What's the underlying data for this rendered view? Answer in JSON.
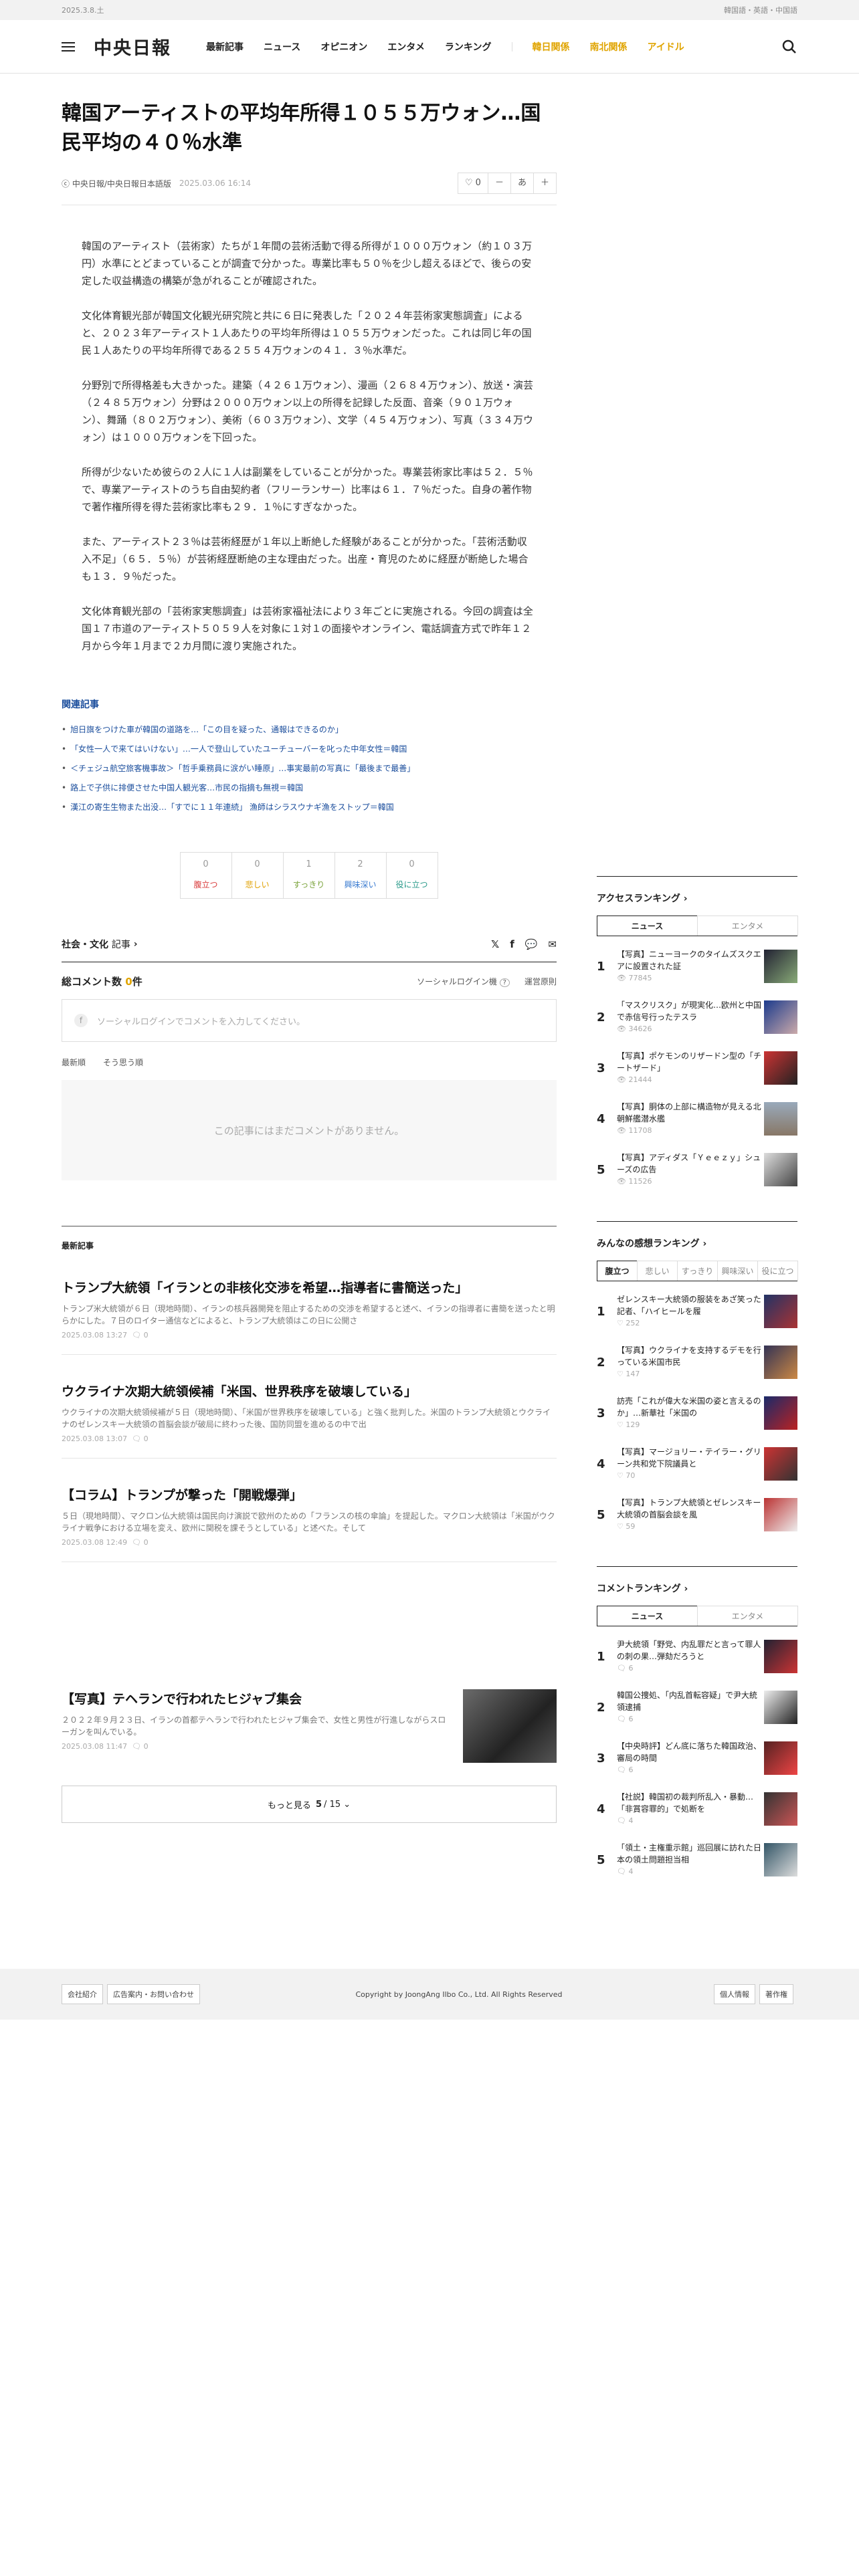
{
  "topbar": {
    "date": "2025.3.8.土",
    "langs": "韓国語・英語・中国語"
  },
  "header": {
    "logo": "中央日報",
    "nav": [
      "最新記事",
      "ニュース",
      "オピニオン",
      "エンタメ",
      "ランキング"
    ],
    "nav_hl": [
      "韓日関係",
      "南北関係",
      "アイドル"
    ]
  },
  "article": {
    "title": "韓国アーティストの平均年所得１０５５万ウォン…国民平均の４０％水準",
    "source": "中央日報/中央日報日本語版",
    "date": "2025.03.06 16:14",
    "likes": "0",
    "tools": {
      "minus": "－",
      "font": "あ",
      "plus": "＋"
    },
    "paragraphs": [
      "韓国のアーティスト（芸術家）たちが１年間の芸術活動で得る所得が１０００万ウォン（約１０３万円）水準にとどまっていることが調査で分かった。専業比率も５０％を少し超えるほどで、後らの安定した収益構造の構築が急がれることが確認された。",
      "文化体育観光部が韓国文化観光研究院と共に６日に発表した「２０２４年芸術家実態調査」によると、２０２３年アーティスト１人あたりの平均年所得は１０５５万ウォンだった。これは同じ年の国民１人あたりの平均年所得である２５５４万ウォンの４１．３％水準だ。",
      "分野別で所得格差も大きかった。建築（４２６１万ウォン）、漫画（２６８４万ウォン）、放送・演芸（２４８５万ウォン）分野は２０００万ウォン以上の所得を記録した反面、音楽（９０１万ウォン）、舞踊（８０２万ウォン）、美術（６０３万ウォン）、文学（４５４万ウォン）、写真（３３４万ウォン）は１０００万ウォンを下回った。",
      "所得が少ないため彼らの２人に１人は副業をしていることが分かった。専業芸術家比率は５２．５％で、専業アーティストのうち自由契約者（フリーランサー）比率は６１．７％だった。自身の著作物で著作権所得を得た芸術家比率も２９．１％にすぎなかった。",
      "また、アーティスト２３％は芸術経歴が１年以上断絶した経験があることが分かった。「芸術活動収入不足」（６５．５％）が芸術経歴断絶の主な理由だった。出産・育児のために経歴が断絶した場合も１３．９％だった。",
      "文化体育観光部の「芸術家実態調査」は芸術家福祉法により３年ごとに実施される。今回の調査は全国１７市道のアーティスト５０５９人を対象に１対１の面接やオンライン、電話調査方式で昨年１２月から今年１月まで２カ月間に渡り実施された。"
    ]
  },
  "related": {
    "title": "関連記事",
    "items": [
      "旭日旗をつけた車が韓国の道路を…「この目を疑った、通報はできるのか」",
      "「女性一人で来てはいけない」…一人で登山していたユーチューバーを叱った中年女性＝韓国",
      "＜チェジュ航空旅客機事故＞「哲手乗務員に涙がい睡原」…事実最前の写真に「最後まで最善」",
      "路上で子供に排便させた中国人観光客…市民の指摘も無視＝韓国",
      "漢江の寄生生物また出没…「すでに１１年連続」 漁師はシラスウナギ漁をストップ＝韓国"
    ]
  },
  "reactions": [
    {
      "count": "0",
      "label": "腹立つ",
      "color": "#d93c3c"
    },
    {
      "count": "0",
      "label": "悲しい",
      "color": "#e0a000"
    },
    {
      "count": "1",
      "label": "すっきり",
      "color": "#7aa33a"
    },
    {
      "count": "2",
      "label": "興味深い",
      "color": "#3a7bd0"
    },
    {
      "count": "0",
      "label": "役に立つ",
      "color": "#2a9a8a"
    }
  ],
  "section": {
    "name": "社会・文化",
    "suffix": "記事",
    "share": [
      "𝕏",
      "f",
      "💬",
      "✉"
    ]
  },
  "comments": {
    "label": "総コメント数",
    "count": "0",
    "unit": "件",
    "login": "ソーシャルログイン機",
    "help": "?",
    "policy": "運営原則",
    "placeholder": "ソーシャルログインでコメントを入力してください。",
    "sort": [
      "最新順",
      "そう思う順"
    ],
    "empty": "この記事にはまだコメントがありません。"
  },
  "latest": {
    "title": "最新記事",
    "items": [
      {
        "title": "トランプ大統領「イランとの非核化交渉を希望…指導者に書簡送った」",
        "desc": "トランプ米大統領が６日（現地時間）、イランの核兵器開発を阻止するための交渉を希望すると述べ、イランの指導者に書簡を送ったと明らかにした。７日のロイター通信などによると、トランプ大統領はこの日に公開さ",
        "date": "2025.03.08 13:27",
        "cm": "0"
      },
      {
        "title": "ウクライナ次期大統領候補「米国、世界秩序を破壊している」",
        "desc": "ウクライナの次期大統領候補が５日（現地時間）、「米国が世界秩序を破壊している」と強く批判した。米国のトランプ大統領とウクライナのゼレンスキー大統領の首脳会談が破局に終わった後、国防同盟を進めるの中で出",
        "date": "2025.03.08 13:07",
        "cm": "0"
      },
      {
        "title": "【コラム】トランプが撃った「開戦爆弾」",
        "desc": "５日（現地時間）、マクロン仏大統領は国民向け演説で欧州のための「フランスの核の傘論」を提起した。マクロン大統領は「米国がウクライナ戦争における立場を変え、欧州に関税を課そうとしている」と述べた。そして",
        "date": "2025.03.08 12:49",
        "cm": "0"
      }
    ],
    "photo": {
      "title": "【写真】テヘランで行われたヒジャブ集会",
      "desc": "２０２２年９月２３日、イランの首都テヘランで行われたヒジャブ集会で、女性と男性が行進しながらスローガンを叫んでいる。",
      "date": "2025.03.08 11:47",
      "cm": "0"
    },
    "more": {
      "label": "もっと見る",
      "page": "5",
      "total": "15"
    }
  },
  "access": {
    "title": "アクセスランキング",
    "tabs": [
      "ニュース",
      "エンタメ"
    ],
    "items": [
      {
        "n": "1",
        "t": "【写真】ニューヨークのタイムズスクエアに設置された証",
        "v": "77845"
      },
      {
        "n": "2",
        "t": "「マスクリスク」が現実化…欧州と中国で赤信号行ったテスラ",
        "v": "34626"
      },
      {
        "n": "3",
        "t": "【写真】ポケモンのリザードン型の「チートザード」",
        "v": "21444"
      },
      {
        "n": "4",
        "t": "【写真】胴体の上部に構造物が見える北朝鮮艦潜水艦",
        "v": "11708"
      },
      {
        "n": "5",
        "t": "【写真】アディダス「Ｙｅｅｚｙ」シューズの広告",
        "v": "11526"
      }
    ]
  },
  "thanks": {
    "title": "みんなの感想ランキング",
    "tabs": [
      "腹立つ",
      "悲しい",
      "すっきり",
      "興味深い",
      "役に立つ"
    ],
    "items": [
      {
        "n": "1",
        "t": "ゼレンスキー大統領の服装をあざ笑った記者、「ハイヒールを履",
        "v": "252"
      },
      {
        "n": "2",
        "t": "【写真】ウクライナを支持するデモを行っている米国市民",
        "v": "147"
      },
      {
        "n": "3",
        "t": "訪売「これが偉大な米国の姿と言えるのか」…新華社「米国の",
        "v": "129"
      },
      {
        "n": "4",
        "t": "【写真】マージョリー・テイラー・グリーン共和党下院議員と",
        "v": "70"
      },
      {
        "n": "5",
        "t": "【写真】トランプ大統領とゼレンスキー大統領の首脳会談を風",
        "v": "59"
      }
    ]
  },
  "commentrank": {
    "title": "コメントランキング",
    "tabs": [
      "ニュース",
      "エンタメ"
    ],
    "items": [
      {
        "n": "1",
        "t": "尹大統領「野党、内乱罪だと言って罪人の刺の果…弾劾だろうと",
        "v": "6"
      },
      {
        "n": "2",
        "t": "韓国公捜処、「内乱首転容疑」で尹大統領逮捕",
        "v": "6"
      },
      {
        "n": "3",
        "t": "【中央時評】どん底に落ちた韓国政治、審局の時間",
        "v": "6"
      },
      {
        "n": "4",
        "t": "【社説】韓国初の裁判所乱入・暴動…「非賞容罪的」で処断を",
        "v": "4"
      },
      {
        "n": "5",
        "t": "「領土・主権重示館」巡回展に訪れた日本の領土問題担当相",
        "v": "4"
      }
    ]
  },
  "footer": {
    "left": [
      "会社紹介",
      "広告案内・お問い合わせ"
    ],
    "copy": "Copyright by JoongAng Ilbo Co., Ltd. All Rights Reserved",
    "right": [
      "個人情報",
      "著作権"
    ]
  }
}
